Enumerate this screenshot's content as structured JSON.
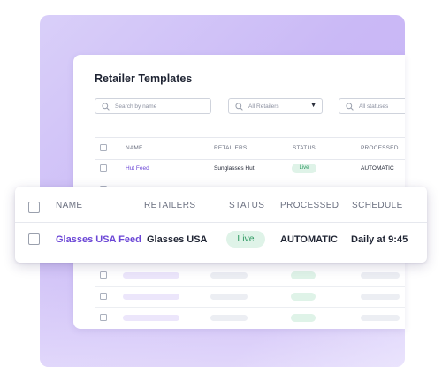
{
  "card": {
    "title": "Retailer Templates"
  },
  "filters": {
    "search_placeholder": "Search by name",
    "retailer_select": "All Retailers",
    "status_select": "All statuses"
  },
  "table": {
    "columns": [
      "NAME",
      "RETAILERS",
      "STATUS",
      "PROCESSED"
    ],
    "first_row": {
      "name": "Hut Feed",
      "retailer": "Sunglasses Hut",
      "status": "Live",
      "processed": "AUTOMATIC"
    }
  },
  "zoom": {
    "columns": [
      "NAME",
      "RETAILERS",
      "STATUS",
      "PROCESSED",
      "SCHEDULE"
    ],
    "row": {
      "name": "Glasses USA Feed",
      "retailer": "Glasses USA",
      "status": "Live",
      "processed": "AUTOMATIC",
      "schedule": "Daily at 9:45"
    }
  },
  "colors": {
    "accent": "#6b46d6",
    "live_bg": "#dff3e8",
    "live_text": "#2f9a63",
    "backdrop": "#cab9f6"
  },
  "icons": {
    "search": "search-icon",
    "dropdown": "caret-down-icon"
  }
}
